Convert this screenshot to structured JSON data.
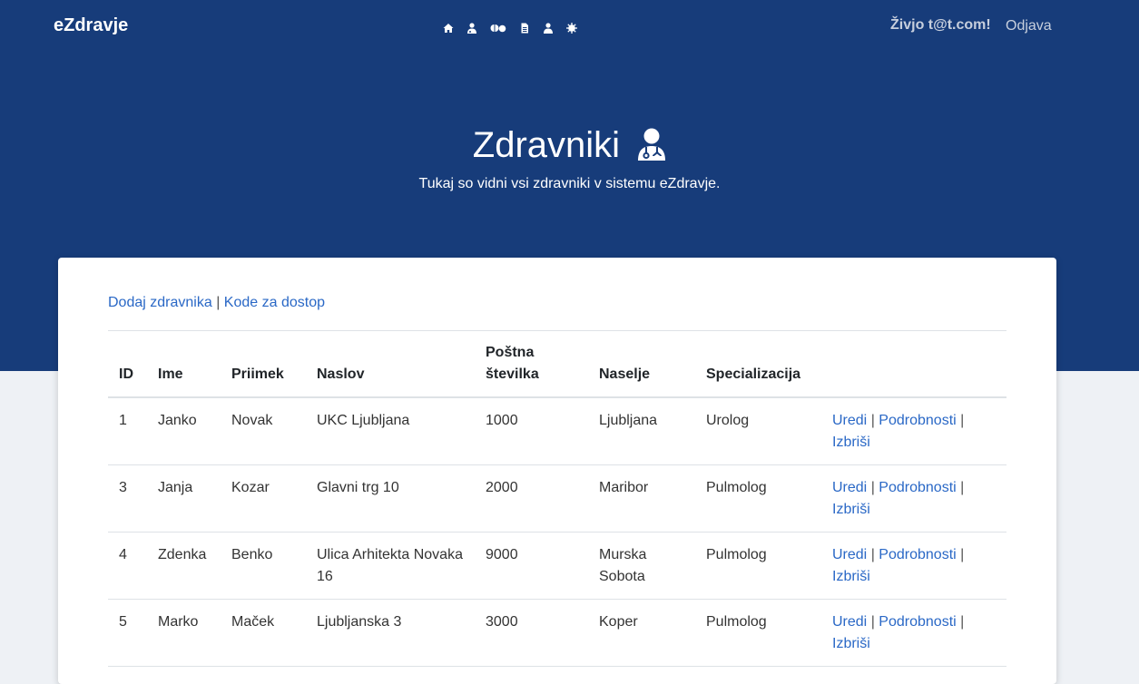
{
  "navbar": {
    "brand": "eZdravje",
    "icons": [
      "home-icon",
      "doctor-icon",
      "pills-icon",
      "document-icon",
      "user-icon",
      "virus-icon"
    ],
    "greeting": "Živjo t@t.com!",
    "logout_label": "Odjava"
  },
  "hero": {
    "title": "Zdravniki",
    "subtitle": "Tukaj so vidni vsi zdravniki v sistemu eZdravje."
  },
  "actions": {
    "add_label": "Dodaj zdravnika",
    "separator": "|",
    "codes_label": "Kode za dostop"
  },
  "table": {
    "headers": [
      "ID",
      "Ime",
      "Priimek",
      "Naslov",
      "Poštna številka",
      "Naselje",
      "Specializacija",
      ""
    ],
    "rows": [
      {
        "id": "1",
        "ime": "Janko",
        "priimek": "Novak",
        "naslov": "UKC Ljubljana",
        "postna": "1000",
        "naselje": "Ljubljana",
        "spec": "Urolog"
      },
      {
        "id": "3",
        "ime": "Janja",
        "priimek": "Kozar",
        "naslov": "Glavni trg 10",
        "postna": "2000",
        "naselje": "Maribor",
        "spec": "Pulmolog"
      },
      {
        "id": "4",
        "ime": "Zdenka",
        "priimek": "Benko",
        "naslov": "Ulica Arhitekta Novaka 16",
        "postna": "9000",
        "naselje": "Murska Sobota",
        "spec": "Pulmolog"
      },
      {
        "id": "5",
        "ime": "Marko",
        "priimek": "Maček",
        "naslov": "Ljubljanska 3",
        "postna": "3000",
        "naselje": "Koper",
        "spec": "Pulmolog"
      }
    ],
    "row_actions": {
      "edit": "Uredi",
      "details": "Podrobnosti",
      "delete": "Izbriši",
      "separator": "|"
    }
  },
  "colors": {
    "primary": "#173c7a",
    "link": "#2a68c6",
    "background": "#eef1f5"
  }
}
